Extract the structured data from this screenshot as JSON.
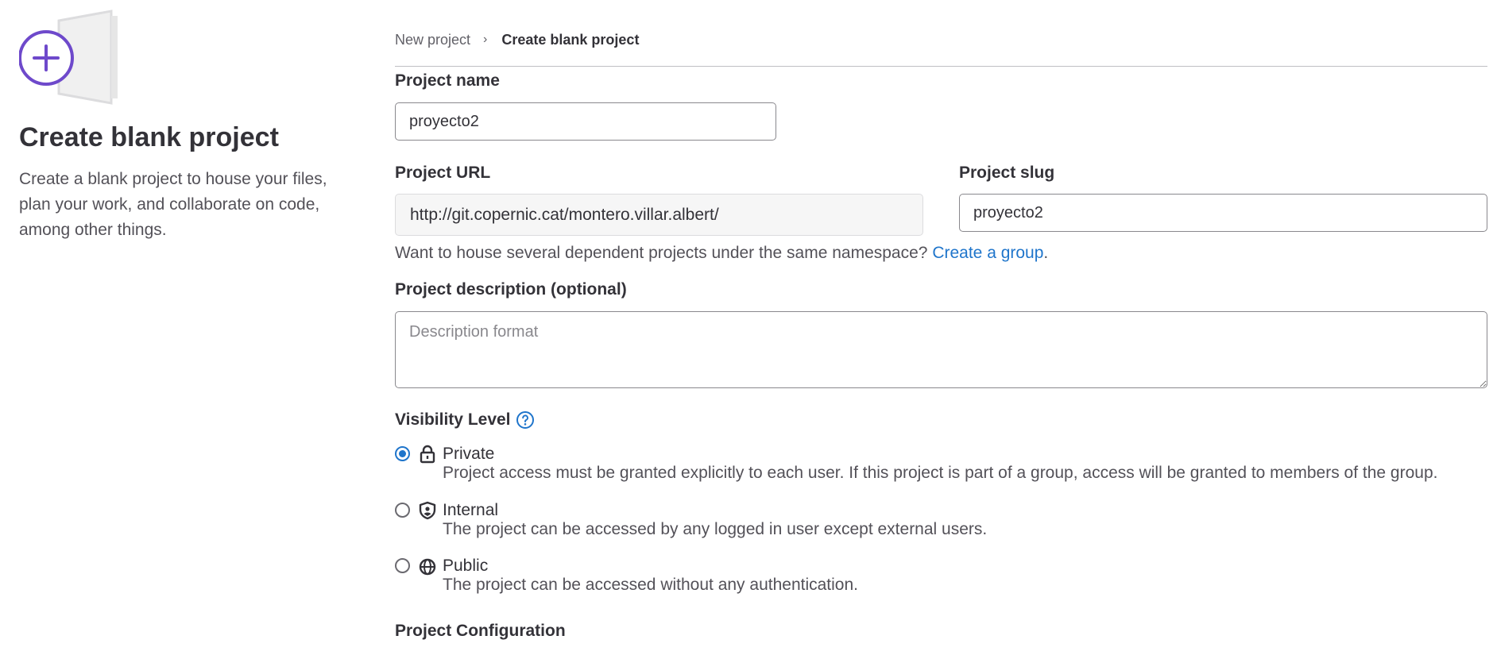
{
  "intro": {
    "title": "Create blank project",
    "description": "Create a blank project to house your files, plan your work, and collaborate on code, among other things."
  },
  "breadcrumb": {
    "parent": "New project",
    "current": "Create blank project"
  },
  "form": {
    "project_name": {
      "label": "Project name",
      "value": "proyecto2"
    },
    "project_url": {
      "label": "Project URL",
      "value": "http://git.copernic.cat/montero.villar.albert/"
    },
    "project_slug": {
      "label": "Project slug",
      "value": "proyecto2"
    },
    "namespace_help": {
      "text": "Want to house several dependent projects under the same namespace?",
      "link": "Create a group",
      "suffix": "."
    },
    "description": {
      "label": "Project description (optional)",
      "placeholder": "Description format"
    }
  },
  "visibility": {
    "title": "Visibility Level",
    "help_icon": "question-circle-icon",
    "options": [
      {
        "label": "Private",
        "icon": "lock-icon",
        "description": "Project access must be granted explicitly to each user. If this project is part of a group, access will be granted to members of the group.",
        "checked": true
      },
      {
        "label": "Internal",
        "icon": "shield-icon",
        "description": "The project can be accessed by any logged in user except external users.",
        "checked": false
      },
      {
        "label": "Public",
        "icon": "globe-icon",
        "description": "The project can be accessed without any authentication.",
        "checked": false
      }
    ]
  },
  "configuration": {
    "title": "Project Configuration"
  },
  "colors": {
    "accent": "#1f75cb",
    "illustration_purple": "#6e49cb"
  }
}
